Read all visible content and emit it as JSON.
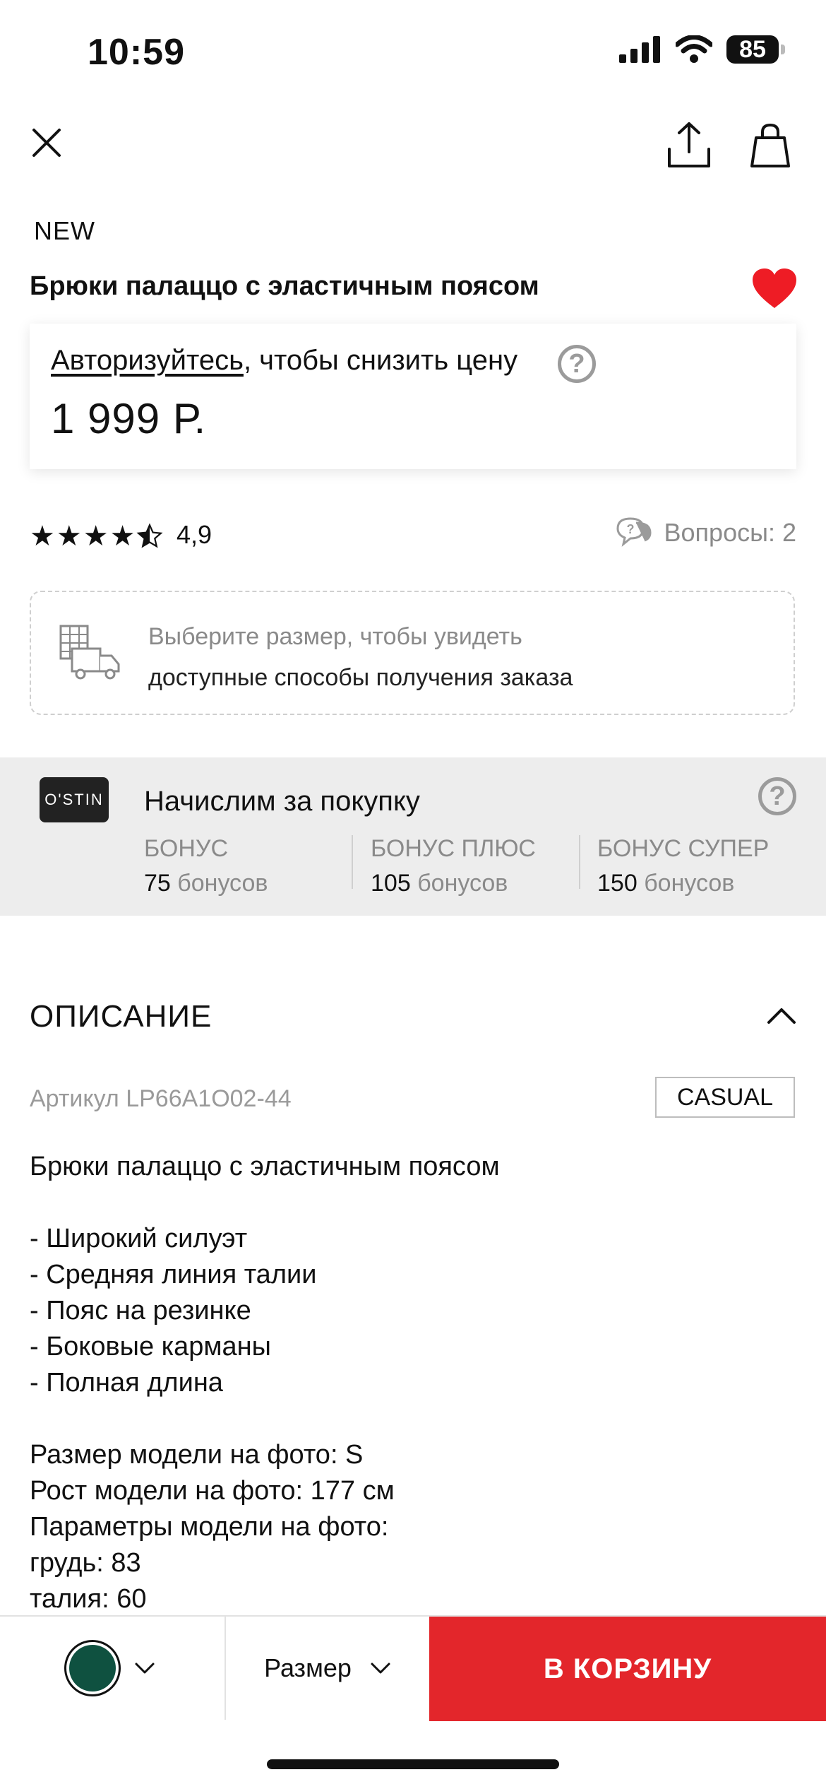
{
  "status_bar": {
    "time": "10:59",
    "battery": "85"
  },
  "product": {
    "badge": "NEW",
    "title": "Брюки палаццо с эластичным поясом",
    "favorite": true,
    "auth_link": "Авторизуйтесь",
    "auth_rest": ", чтобы снизить цену",
    "price": "1 999 Р.",
    "rating_value": "4,9",
    "rating_stars": 4.5,
    "questions_label": "Вопросы: 2"
  },
  "delivery": {
    "line1": "Выберите размер, чтобы увидеть",
    "line2": "доступные способы получения заказа"
  },
  "bonus": {
    "logo": "O'STIN",
    "title": "Начислим за покупку",
    "tiers": [
      {
        "name": "БОНУС",
        "amount": "75",
        "unit": "бонусов"
      },
      {
        "name": "БОНУС ПЛЮС",
        "amount": "105",
        "unit": "бонусов"
      },
      {
        "name": "БОНУС СУПЕР",
        "amount": "150",
        "unit": "бонусов"
      }
    ]
  },
  "description": {
    "heading": "ОПИСАНИЕ",
    "sku": "Артикул LP66A1O02-44",
    "style_tag": "CASUAL",
    "lines": [
      "Брюки палаццо с эластичным поясом",
      "",
      "- Широкий силуэт",
      "- Средняя линия талии",
      "- Пояс на резинке",
      "- Боковые карманы",
      "- Полная длина",
      "",
      "Размер модели на фото: S",
      "Рост модели на фото: 177 см",
      "Параметры модели на фото:",
      "грудь: 83",
      "талия: 60"
    ]
  },
  "bottom_bar": {
    "selected_color": "#0f5140",
    "size_label": "Размер",
    "cart_label": "В КОРЗИНУ"
  },
  "colors": {
    "accent": "#e3262b",
    "bonus_bg": "#ededed"
  }
}
